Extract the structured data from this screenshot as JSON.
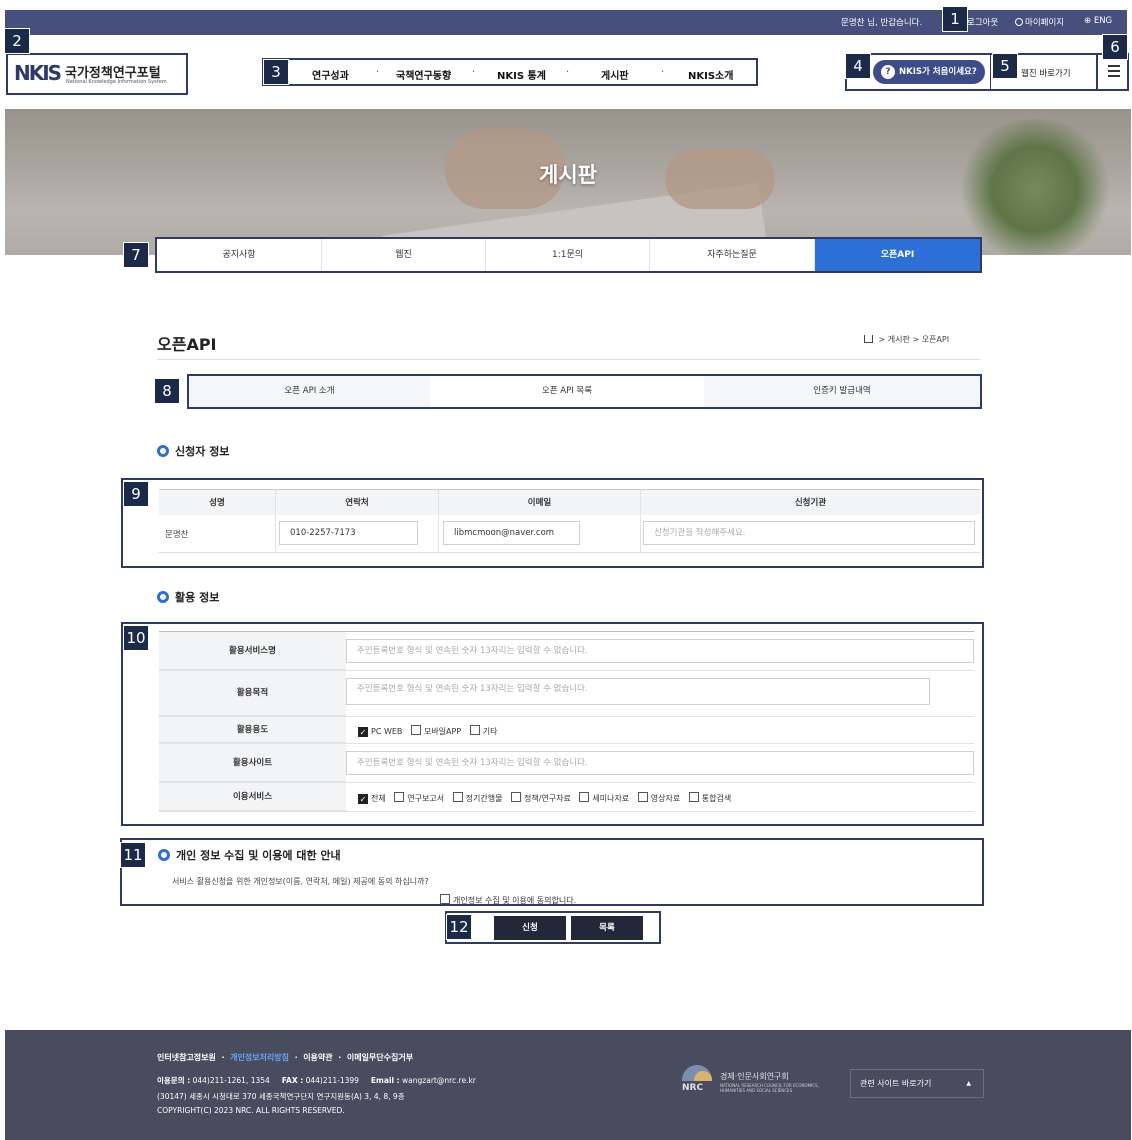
{
  "topbar": {
    "greeting": "문명찬 님, 반갑습니다.",
    "logout": "로그아웃",
    "mypage": "마이페이지",
    "lang": "ENG"
  },
  "markers": [
    "1",
    "2",
    "3",
    "4",
    "5",
    "6",
    "7",
    "8",
    "9",
    "10",
    "11",
    "12"
  ],
  "logo": {
    "mark": "NKIS",
    "name_kr": "국가정책연구포털",
    "name_en": "National Knowledge Information System"
  },
  "gnb": {
    "items": [
      "연구성과",
      "국책연구동향",
      "NKIS 통계",
      "게시판",
      "NKIS소개"
    ],
    "separator": "·"
  },
  "util": {
    "first_time": "NKIS가 처음이세요?",
    "webzine": "웹진 바로가기"
  },
  "hero": {
    "title": "게시판"
  },
  "board_tabs": {
    "items": [
      "공지사항",
      "웹진",
      "1:1문의",
      "자주하는질문",
      "오픈API"
    ],
    "active": "오픈API"
  },
  "page": {
    "title": "오픈API",
    "breadcrumb": [
      "게시판",
      "오픈API"
    ],
    "breadcrumb_sep": ">"
  },
  "api_tabs": {
    "items": [
      "오픈 API 소개",
      "오픈 API 목록",
      "인증키 발급내역"
    ],
    "active": "오픈 API 목록"
  },
  "applicant": {
    "heading": "신청자 정보",
    "columns": [
      "성명",
      "연락처",
      "이메일",
      "신청기관"
    ],
    "name": "문명찬",
    "phone": "010-2257-7173",
    "email": "libmcmoon@naver.com",
    "org_placeholder": "신청기관을 작성해주세요."
  },
  "usage": {
    "heading": "활용 정보",
    "labels": [
      "활용서비스명",
      "활용목적",
      "활용용도",
      "활용사이트",
      "이용서비스"
    ],
    "placeholder": "주민등록번호 형식 및 연속된 숫자 13자리는 입력할 수 없습니다.",
    "purpose_options": [
      {
        "label": "PC WEB",
        "checked": true
      },
      {
        "label": "모바일APP",
        "checked": false
      },
      {
        "label": "기타",
        "checked": false
      }
    ],
    "service_options": [
      {
        "label": "전체",
        "checked": true
      },
      {
        "label": "연구보고서",
        "checked": false
      },
      {
        "label": "정기간행물",
        "checked": false
      },
      {
        "label": "정책/연구자료",
        "checked": false
      },
      {
        "label": "세미나자료",
        "checked": false
      },
      {
        "label": "영상자료",
        "checked": false
      },
      {
        "label": "통합검색",
        "checked": false
      }
    ]
  },
  "privacy": {
    "heading": "개인 정보 수집 및 이용에 대한 안내",
    "question": "서비스 활용신청을 위한 개인정보(이름, 연락처, 메일) 제공에 동의 하십니까?",
    "agree_label": "개인정보 수집 및 이용에 동의합니다.",
    "agreed": false
  },
  "buttons": {
    "apply": "신청",
    "list": "목록"
  },
  "footer": {
    "links": [
      "인터넷참고정보원",
      "개인정보처리방침",
      "이용약관",
      "이메일무단수집거부"
    ],
    "link_sep": "·",
    "contact_label": "이용문의 :",
    "phone": "044)211-1261, 1354",
    "fax_label": "FAX :",
    "fax": "044)211-1399",
    "email_label": "Email :",
    "email": "wangzart@nrc.re.kr",
    "address": "(30147) 세종시 시청대로 370 세종국책연구단지 연구지원동(A) 3, 4, 8, 9층",
    "copyright": "COPYRIGHT(C) 2023 NRC. ALL RIGHTS RESERVED.",
    "nrc_abbr": "NRC",
    "nrc_kr": "경제·인문사회연구회",
    "nrc_en": "NATIONAL RESEARCH COUNCIL FOR ECONOMICS, HUMANITIES AND SOCIAL SCIENCES",
    "related_sites": "관련 사이트 바로가기",
    "related_caret": "▲"
  },
  "colors": {
    "topbar": "#474f7d",
    "accent": "#2c6fd6",
    "marker": "#1c2a4a",
    "button": "#22273a",
    "footer": "#484c5e"
  }
}
